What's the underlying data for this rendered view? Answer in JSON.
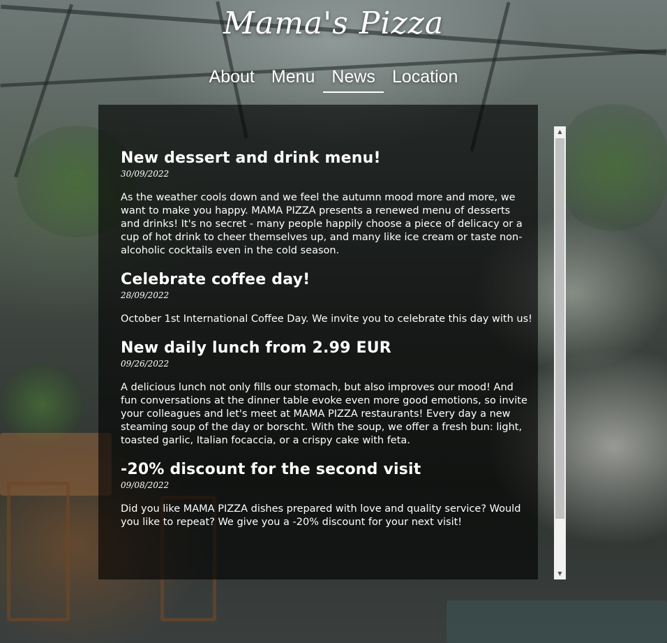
{
  "brand": {
    "logo": "Mama's Pizza"
  },
  "nav": {
    "items": [
      {
        "label": "About",
        "active": false
      },
      {
        "label": "Menu",
        "active": false
      },
      {
        "label": "News",
        "active": true
      },
      {
        "label": "Location",
        "active": false
      }
    ]
  },
  "news": [
    {
      "title": "New dessert and drink menu!",
      "date": "30/09/2022",
      "body": "As the weather cools down and we feel the autumn mood more and more, we want to make you happy. MAMA PIZZA presents a renewed menu of desserts and drinks! It's no secret - many people happily choose a piece of delicacy or a cup of hot drink to cheer themselves up, and many like ice cream or taste non-alcoholic cocktails even in the cold season."
    },
    {
      "title": "Celebrate coffee day!",
      "date": "28/09/2022",
      "body": "October 1st International Coffee Day. We invite you to celebrate this day with us!"
    },
    {
      "title": "New daily lunch from 2.99 EUR",
      "date": "09/26/2022",
      "body": "A delicious lunch not only fills our stomach, but also improves our mood! And fun conversations at the dinner table evoke even more good emotions, so invite your colleagues and let's meet at MAMA PIZZA restaurants! Every day a new steaming soup of the day or borscht. With the soup, we offer a fresh bun: light, toasted garlic, Italian focaccia, or a crispy cake with feta."
    },
    {
      "title": "-20% discount for the second visit",
      "date": "09/08/2022",
      "body": "Did you like MAMA PIZZA dishes prepared with love and quality service? Would you like to repeat? We give you a -20% discount for your next visit!"
    }
  ],
  "scrollbar": {
    "up_icon": "▲",
    "down_icon": "▼"
  },
  "colors": {
    "panel": "#000000",
    "text": "#ffffff",
    "scroll_track": "#f1f1f1",
    "scroll_thumb": "#c1c1c1"
  }
}
